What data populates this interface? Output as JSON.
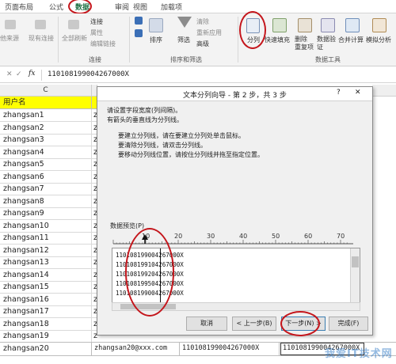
{
  "ribbon_tabs": [
    "页面布局",
    "公式",
    "数据",
    "审阅",
    "视图",
    "加载项"
  ],
  "ribbon": {
    "get_source": "他来源",
    "existing_conn": "现有连接",
    "refresh_all": "全部刷新",
    "connections": "连接",
    "properties": "属性",
    "edit_links": "编辑链接",
    "group_connections": "连接",
    "sort": "排序",
    "filter": "筛选",
    "clear": "清除",
    "reapply": "重新应用",
    "advanced": "高级",
    "group_sort_filter": "排序和筛选",
    "text_to_columns": "分列",
    "flash_fill": "快速填充",
    "remove_dup": "删除\n重复项",
    "data_validation": "数据验\n证",
    "consolidate": "合并计算",
    "what_if": "模拟分析",
    "group_data_tools": "数据工具"
  },
  "formula_bar": {
    "cancel": "✕",
    "enter": "✓",
    "fx": "fx",
    "value": "110108199004267000X"
  },
  "columns": [
    "C"
  ],
  "header_cell": "用户名",
  "rows": [
    {
      "name": "zhangsan1",
      "b": "z"
    },
    {
      "name": "zhangsan2",
      "b": "z"
    },
    {
      "name": "zhangsan3",
      "b": "z"
    },
    {
      "name": "zhangsan4",
      "b": "z"
    },
    {
      "name": "zhangsan5",
      "b": "z"
    },
    {
      "name": "zhangsan6",
      "b": "z"
    },
    {
      "name": "zhangsan7",
      "b": "z"
    },
    {
      "name": "zhangsan8",
      "b": "z"
    },
    {
      "name": "zhangsan9",
      "b": "z"
    },
    {
      "name": "zhangsan10",
      "b": "z"
    },
    {
      "name": "zhangsan11",
      "b": "z"
    },
    {
      "name": "zhangsan12",
      "b": "z"
    },
    {
      "name": "zhangsan13",
      "b": "z"
    },
    {
      "name": "zhangsan14",
      "b": "z"
    },
    {
      "name": "zhangsan15",
      "b": "z"
    },
    {
      "name": "zhangsan16",
      "b": "z"
    },
    {
      "name": "zhangsan17",
      "b": "z"
    },
    {
      "name": "zhangsan18",
      "b": "z"
    },
    {
      "name": "zhangsan19",
      "b": "z"
    }
  ],
  "last_row": {
    "name": "zhangsan20",
    "email": "zhangsan20@xxx.com",
    "id": "110108199004267000X",
    "id2": "110108199004267000X"
  },
  "dialog": {
    "title": "文本分列向导 - 第 2 步，共 3 步",
    "help": "?",
    "close": "✕",
    "intro1": "请设置字段宽度(列间隔)。",
    "intro2": "有箭头的垂直线为分列线。",
    "tip1": "要建立分列线，请在要建立分列处单击鼠标。",
    "tip2": "要清除分列线，请双击分列线。",
    "tip3": "要移动分列线位置，请按住分列线并拖至指定位置。",
    "preview_label": "数据预览(P)",
    "ruler_labels": [
      "10",
      "20",
      "30",
      "40",
      "50",
      "60",
      "70"
    ],
    "preview_lines": [
      "110108199004267000X",
      "110108199104267000X",
      "110108199204267000X",
      "110108199504267000X",
      "110108199004267000X"
    ],
    "btn_cancel": "取消",
    "btn_back": "< 上一步(B)",
    "btn_next": "下一步(N) >",
    "btn_finish": "完成(F)"
  },
  "watermark": "我爱IT技术网",
  "colors": {
    "annotation": "#c4161c",
    "header_fill": "#ffff00",
    "dialog_bg": "#f0f0f0"
  }
}
